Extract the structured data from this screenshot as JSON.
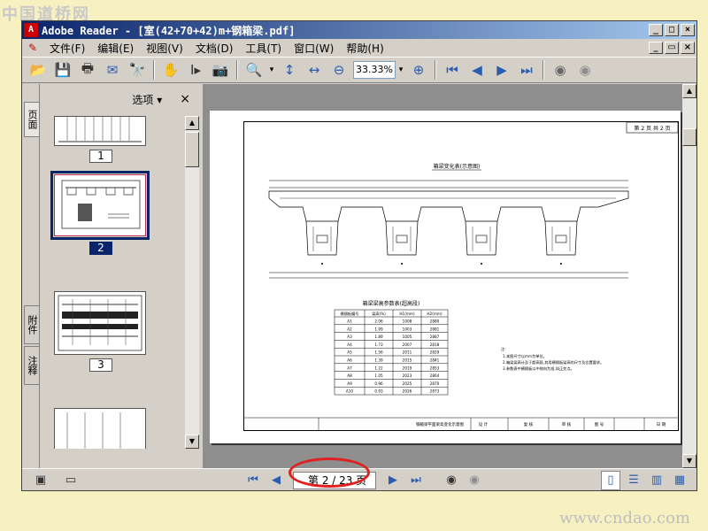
{
  "watermarks": {
    "top": "中国道桥网",
    "bottom": "www.cndao.com"
  },
  "window": {
    "title": "Adobe Reader - [室(42+70+42)m+钢箱梁.pdf]"
  },
  "title_buttons": {
    "minimize": "_",
    "maximize": "□",
    "close": "×"
  },
  "doc_buttons": {
    "minimize": "_",
    "restore": "▭",
    "close": "×"
  },
  "menu": [
    "文件(F)",
    "编辑(E)",
    "视图(V)",
    "文档(D)",
    "工具(T)",
    "窗口(W)",
    "帮助(H)"
  ],
  "toolbar": {
    "zoom": "33.33%",
    "icons": [
      "open-icon",
      "save-icon",
      "print-icon",
      "email-icon",
      "search-icon",
      "hand-icon",
      "select-text-icon",
      "snapshot-icon",
      "zoom-in-icon",
      "fit-page-icon",
      "fit-width-icon",
      "zoom-out-minus-icon",
      "zoom-in-plus-icon",
      "first-page-icon",
      "prev-page-icon",
      "next-page-icon",
      "last-page-icon",
      "back-icon",
      "forward-icon"
    ]
  },
  "left_tabs": {
    "pages": "页面",
    "attachments": "附件",
    "comments": "注释"
  },
  "panel": {
    "options": "选项 ▾",
    "close": "×"
  },
  "thumbnails": [
    {
      "label": "1",
      "selected": false
    },
    {
      "label": "2",
      "selected": true
    },
    {
      "label": "3",
      "selected": false
    }
  ],
  "document": {
    "page_tag": "第 2 页 共 2 页",
    "section_title": "箱梁变化表(示意图)",
    "table_title": "箱梁梁高参数表(超高段)",
    "table_headers": [
      "横隔板编号",
      "梁高(%)",
      "H1(mm)",
      "H2(mm)"
    ],
    "table_rows": [
      [
        "A1",
        "2.06",
        "1008",
        "2880"
      ],
      [
        "A2",
        "1.99",
        "1003",
        "2881"
      ],
      [
        "A3",
        "1.89",
        "1005",
        "2887"
      ],
      [
        "A4",
        "1.73",
        "2007",
        "2818"
      ],
      [
        "A5",
        "1.56",
        "2011",
        "2829"
      ],
      [
        "A6",
        "1.39",
        "2015",
        "2841"
      ],
      [
        "A7",
        "1.22",
        "2019",
        "2853"
      ],
      [
        "A8",
        "1.05",
        "2023",
        "2864"
      ],
      [
        "A9",
        "0.96",
        "2025",
        "2870"
      ],
      [
        "A10",
        "0.93",
        "2026",
        "2873"
      ]
    ],
    "notes_title": "注:",
    "notes": [
      "1.本图尺寸以mm为单位。",
      "2.箱梁梁高计及于超高段,其用横隔板梁高的尺寸及位置要求。",
      "3.参数表中横隔板以中侧向为准,如正交点。"
    ],
    "title_block": [
      "钢箱梁平面梁高变化示意图",
      "设 计",
      "复 核",
      "审 核",
      "图 号",
      "日 期"
    ]
  },
  "status": {
    "page_display": "第 2 / 23 页",
    "icons": [
      "page-layout-icon",
      "first-page-icon",
      "prev-page-icon",
      "next-page-icon",
      "last-page-icon",
      "back-icon",
      "forward-icon",
      "single-page-icon",
      "continuous-icon",
      "facing-icon",
      "continuous-facing-icon"
    ]
  },
  "colors": {
    "titlebar": "#0a246a",
    "annotation": "#e02020",
    "selected": "#0a246a"
  }
}
